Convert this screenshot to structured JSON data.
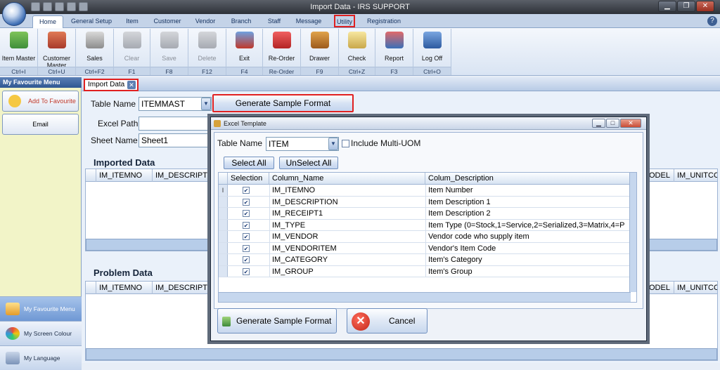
{
  "window": {
    "title": "Import Data - IRS SUPPORT"
  },
  "tabs": [
    {
      "label": "Home"
    },
    {
      "label": "General Setup"
    },
    {
      "label": "Item"
    },
    {
      "label": "Customer"
    },
    {
      "label": "Vendor"
    },
    {
      "label": "Branch"
    },
    {
      "label": "Staff"
    },
    {
      "label": "Message"
    },
    {
      "label": "Utility"
    },
    {
      "label": "Registration"
    }
  ],
  "ribbon": [
    {
      "label": "Item Master",
      "shortcut": "Ctrl+I"
    },
    {
      "label": "Customer Master",
      "shortcut": "Ctrl+U"
    },
    {
      "label": "Sales",
      "shortcut": "Ctrl+F2"
    },
    {
      "label": "Clear",
      "shortcut": "F1"
    },
    {
      "label": "Save",
      "shortcut": "F8"
    },
    {
      "label": "Delete",
      "shortcut": "F12"
    },
    {
      "label": "Exit",
      "shortcut": "F4"
    },
    {
      "label": "Re-Order",
      "shortcut": "Re-Order"
    },
    {
      "label": "Drawer",
      "shortcut": "F9"
    },
    {
      "label": "Check",
      "shortcut": "Ctrl+Z"
    },
    {
      "label": "Report",
      "shortcut": "F3"
    },
    {
      "label": "Log Off",
      "shortcut": "Ctrl+O"
    }
  ],
  "sidebar": {
    "title": "My Favourite Menu",
    "add_favourite": "Add To Favourite",
    "email": "Email",
    "bottom": [
      "My Favourite Menu",
      "My Screen Colour",
      "My Language"
    ]
  },
  "main": {
    "doc_tab": "Import Data",
    "table_name_label": "Table Name",
    "table_name_value": "ITEMMAST",
    "generate_button": "Generate Sample Format",
    "excel_path_label": "Excel Path",
    "excel_path_value": "",
    "sheet_name_label": "Sheet Name",
    "sheet_name_value": "Sheet1",
    "imported_data_title": "Imported Data",
    "problem_data_title": "Problem Data",
    "grid_columns": [
      "IM_ITEMNO",
      "IM_DESCRIPTIO",
      "ODEL",
      "IM_UNITCO"
    ]
  },
  "dialog": {
    "title": "Excel Template",
    "table_name_label": "Table Name",
    "table_name_value": "ITEM",
    "multi_uom_label": "Include Multi-UOM",
    "select_all": "Select All",
    "unselect_all": "UnSelect All",
    "columns": [
      "Selection",
      "Column_Name",
      "Colum_Description"
    ],
    "rows": [
      {
        "name": "IM_ITEMNO",
        "desc": "Item Number"
      },
      {
        "name": "IM_DESCRIPTION",
        "desc": "Item Description 1"
      },
      {
        "name": "IM_RECEIPT1",
        "desc": "Item Description 2"
      },
      {
        "name": "IM_TYPE",
        "desc": "Item Type (0=Stock,1=Service,2=Serialized,3=Matrix,4=P"
      },
      {
        "name": "IM_VENDOR",
        "desc": "Vendor code who supply item"
      },
      {
        "name": "IM_VENDORITEM",
        "desc": "Vendor's Item Code"
      },
      {
        "name": "IM_CATEGORY",
        "desc": "Item's Category"
      },
      {
        "name": "IM_GROUP",
        "desc": "Item's Group"
      }
    ],
    "row_marker": "I",
    "generate_button": "Generate Sample Format",
    "cancel_button": "Cancel"
  }
}
